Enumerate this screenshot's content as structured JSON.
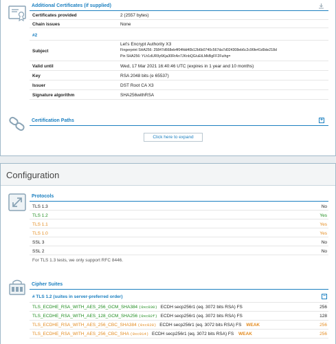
{
  "additional_certs": {
    "title": "Additional Certificates (if supplied)",
    "rows": [
      {
        "key": "Certificates provided",
        "value": "2 (2557 bytes)"
      },
      {
        "key": "Chain issues",
        "value": "None"
      }
    ],
    "sub_header": "#2",
    "subject": {
      "key": "Subject",
      "name": "Let's Encrypt Authority X3",
      "fingerprint": "Fingerprint SHA256: 25847d668eb4f04fdd40b12b6b0740c567da7d024308eb6c2c96fe41d9de218d",
      "pin": "Pin SHA256: YLh1dUR9y6Kja30RrAn7JKnbQG/uEtLMkBgFF2Fuihg="
    },
    "rows2": [
      {
        "key": "Valid until",
        "value": "Wed, 17 Mar 2021 16:40:46 UTC (expires in 1 year and 10 months)"
      },
      {
        "key": "Key",
        "value": "RSA 2048 bits (e 65537)"
      },
      {
        "key": "Issuer",
        "value": "DST Root CA X3"
      },
      {
        "key": "Signature algorithm",
        "value": "SHA256withRSA"
      }
    ]
  },
  "cert_paths": {
    "title": "Certification Paths",
    "expand_label": "Click here to expand",
    "plus": "+"
  },
  "configuration": {
    "title": "Configuration",
    "protocols": {
      "title": "Protocols",
      "rows": [
        {
          "name": "TLS 1.3",
          "value": "No"
        },
        {
          "name": "TLS 1.2",
          "value": "Yes"
        },
        {
          "name": "TLS 1.1",
          "value": "Yes"
        },
        {
          "name": "TLS 1.0",
          "value": "Yes"
        },
        {
          "name": "SSL 3",
          "value": "No"
        },
        {
          "name": "SSL 2",
          "value": "No"
        }
      ],
      "note": "For TLS 1.3 tests, we only support RFC 8446."
    },
    "cipher_suites": {
      "title": "Cipher Suites",
      "group_title": "# TLS 1.2 (suites in server-preferred order)",
      "minus": "−",
      "rows": [
        {
          "name": "TLS_ECDHE_RSA_WITH_AES_256_GCM_SHA384",
          "code": "(0xc030)",
          "kx": "ECDH secp256r1 (eq. 3072 bits RSA)   FS",
          "weak": "",
          "bits": "256"
        },
        {
          "name": "TLS_ECDHE_RSA_WITH_AES_128_GCM_SHA256",
          "code": "(0xc02f)",
          "kx": "ECDH secp256r1 (eq. 3072 bits RSA)   FS",
          "weak": "",
          "bits": "128"
        },
        {
          "name": "TLS_ECDHE_RSA_WITH_AES_256_CBC_SHA384",
          "code": "(0xc028)",
          "kx": "ECDH secp256r1 (eq. 3072 bits RSA)   FS",
          "weak": "WEAK",
          "bits": "256"
        },
        {
          "name": "TLS_ECDHE_RSA_WITH_AES_256_CBC_SHA",
          "code": "(0xc014)",
          "kx": "ECDH secp256r1 (eq. 3072 bits RSA)   FS",
          "weak": "WEAK",
          "bits": "256"
        }
      ]
    }
  },
  "colors": {
    "accent": "#1a7fc0",
    "good": "#1e8c1e",
    "warn": "#e38a1d"
  }
}
